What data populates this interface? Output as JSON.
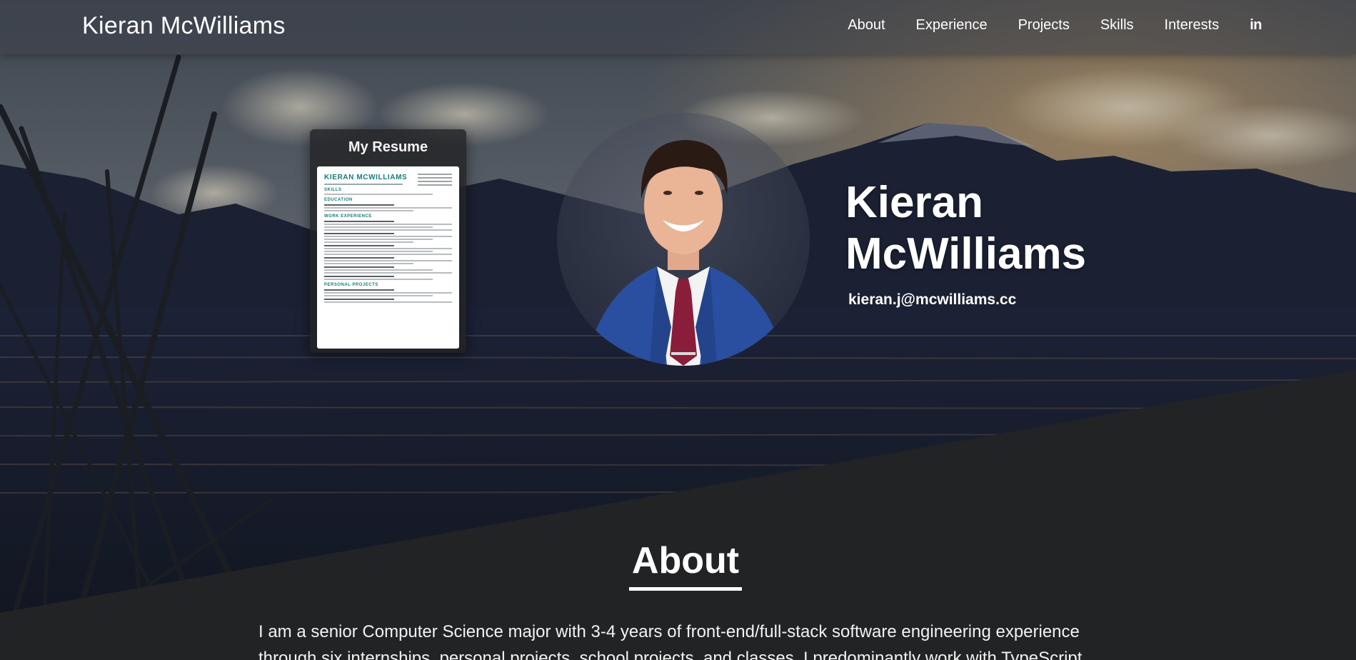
{
  "nav": {
    "brand": "Kieran McWilliams",
    "links": [
      "About",
      "Experience",
      "Projects",
      "Skills",
      "Interests"
    ],
    "linkedin_icon": "linkedin-icon",
    "linkedin_label": "in"
  },
  "resume": {
    "title": "My Resume",
    "preview": {
      "name": "KIERAN MCWILLIAMS",
      "sections": [
        "SKILLS",
        "EDUCATION",
        "WORK EXPERIENCE",
        "PERSONAL PROJECTS"
      ]
    }
  },
  "hero": {
    "name_line1": "Kieran",
    "name_line2": "McWilliams",
    "email": "kieran.j@mcwilliams.cc"
  },
  "about": {
    "heading": "About",
    "text": "I am a senior Computer Science major with 3-4 years of front-end/full-stack software engineering experience through six internships, personal projects, school projects, and classes. I predominantly work with TypeScript"
  },
  "colors": {
    "accent_teal": "#177b78",
    "page_dark": "#222325",
    "nav_overlay": "rgba(60,64,72,0.55)",
    "tie": "#8a1d3a",
    "suit": "#2a4fa0"
  }
}
